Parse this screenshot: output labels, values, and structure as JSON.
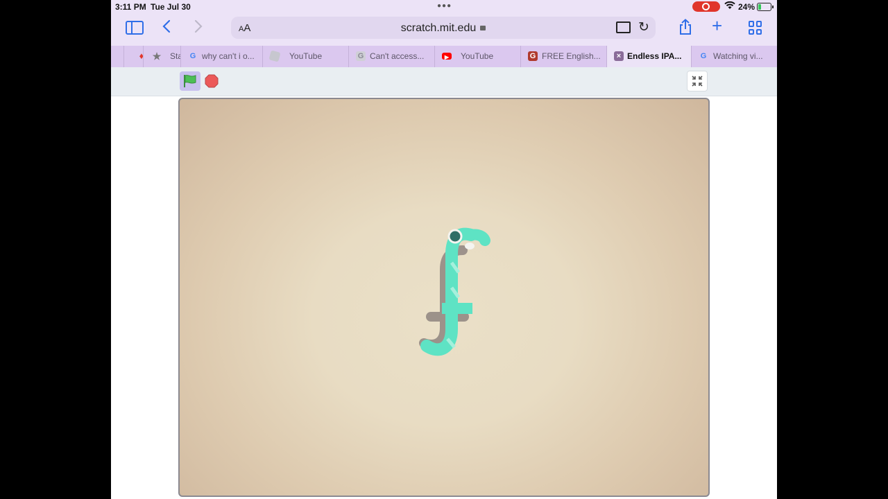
{
  "status_bar": {
    "time": "3:11 PM",
    "date": "Tue Jul 30",
    "battery_percent": "24%",
    "battery_level": 0.24
  },
  "toolbar": {
    "text_size_label": "AA",
    "url": "scratch.mit.edu"
  },
  "tabs": [
    {
      "label": "",
      "icon": "bookmark-red-icon"
    },
    {
      "label": "Sta",
      "icon": "star-icon"
    },
    {
      "label": "why can't i o...",
      "icon": "google-icon"
    },
    {
      "label": "YouTube",
      "icon": "roblox-icon"
    },
    {
      "label": "Can't access...",
      "icon": "generic-g-icon"
    },
    {
      "label": "YouTube",
      "icon": "youtube-icon"
    },
    {
      "label": "FREE English...",
      "icon": "translate-icon"
    },
    {
      "label": "Endless IPA...",
      "icon": "close-x-icon",
      "active": true
    },
    {
      "label": "Watching vi...",
      "icon": "google-icon"
    }
  ],
  "player": {
    "accent": "#c8c0ee",
    "flag_color": "#4cbf56",
    "stop_color": "#ec5959"
  },
  "stage": {
    "glyph_color": "#5ee3c4"
  }
}
